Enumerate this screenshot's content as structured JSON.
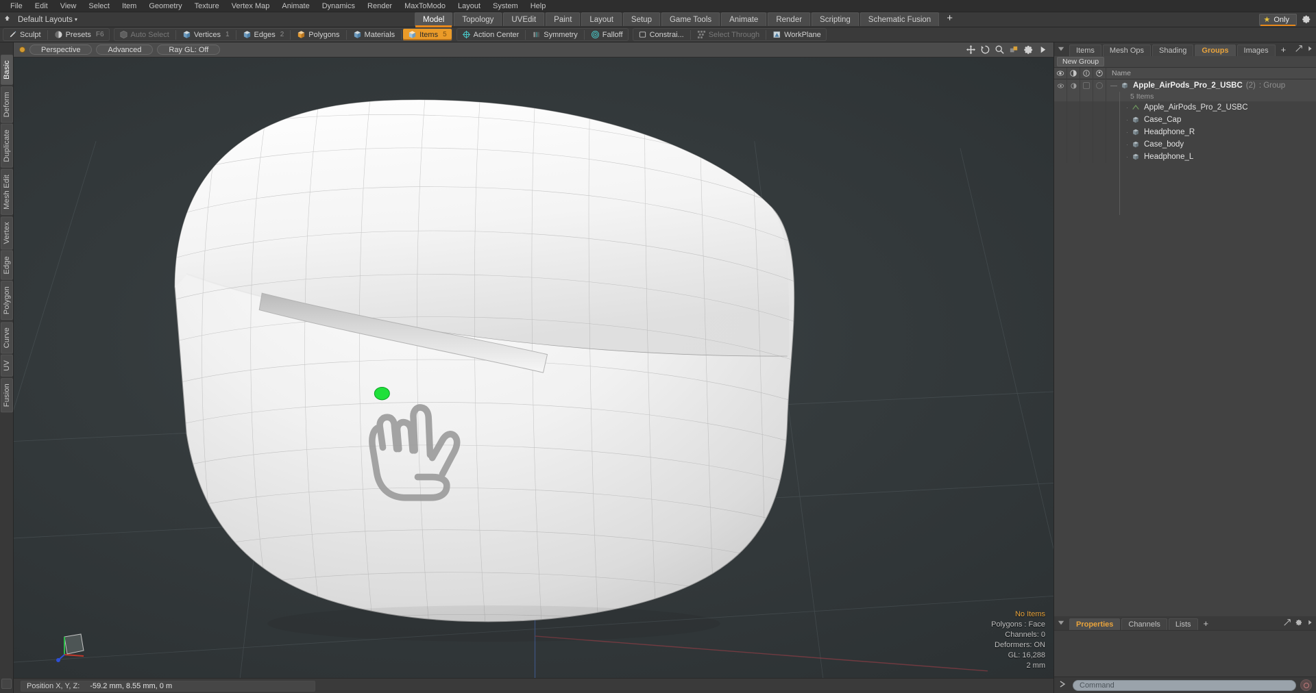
{
  "app": {
    "name": "Modo"
  },
  "menubar": {
    "items": [
      "File",
      "Edit",
      "View",
      "Select",
      "Item",
      "Geometry",
      "Texture",
      "Vertex Map",
      "Animate",
      "Dynamics",
      "Render",
      "MaxToModo",
      "Layout",
      "System",
      "Help"
    ]
  },
  "layoutrow": {
    "up_icon": "up-arrow-icon",
    "default_layouts": "Default Layouts",
    "caret": "▾",
    "tabs": [
      {
        "label": "Model",
        "selected": true
      },
      {
        "label": "Topology",
        "selected": false
      },
      {
        "label": "UVEdit",
        "selected": false
      },
      {
        "label": "Paint",
        "selected": false
      },
      {
        "label": "Layout",
        "selected": false
      },
      {
        "label": "Setup",
        "selected": false
      },
      {
        "label": "Game Tools",
        "selected": false
      },
      {
        "label": "Animate",
        "selected": false
      },
      {
        "label": "Render",
        "selected": false
      },
      {
        "label": "Scripting",
        "selected": false
      },
      {
        "label": "Schematic Fusion",
        "selected": false
      }
    ],
    "add_tab": "+",
    "only_label": "Only",
    "only_star": "★",
    "gear": "gear-icon"
  },
  "toolbar": {
    "groups": [
      {
        "buttons": [
          {
            "label": "Sculpt",
            "icon": "brush-icon",
            "state": "normal",
            "badge": ""
          },
          {
            "label": "Presets",
            "icon": "sphere-icon",
            "state": "normal",
            "badge": "F6"
          }
        ]
      },
      {
        "buttons": [
          {
            "label": "Auto Select",
            "icon": "cube-icon",
            "state": "dim",
            "badge": ""
          },
          {
            "label": "Vertices",
            "icon": "cube-blue-icon",
            "state": "normal",
            "badge": "1"
          },
          {
            "label": "Edges",
            "icon": "cube-blue-icon",
            "state": "normal",
            "badge": "2"
          },
          {
            "label": "Polygons",
            "icon": "cube-orange-icon",
            "state": "normal",
            "badge": ""
          },
          {
            "label": "Materials",
            "icon": "cube-blue-icon",
            "state": "normal",
            "badge": ""
          },
          {
            "label": "Items",
            "icon": "cube-orange-icon",
            "state": "active",
            "badge": "5"
          }
        ]
      },
      {
        "buttons": [
          {
            "label": "Action Center",
            "icon": "target-icon",
            "state": "normal",
            "badge": ""
          },
          {
            "label": "Symmetry",
            "icon": "mirror-icon",
            "state": "normal",
            "badge": ""
          },
          {
            "label": "Falloff",
            "icon": "circles-icon",
            "state": "normal",
            "badge": ""
          }
        ]
      },
      {
        "buttons": [
          {
            "label": "Constrai...",
            "icon": "plane-icon",
            "state": "normal",
            "badge": ""
          },
          {
            "label": "Select Through",
            "icon": "xray-icon",
            "state": "dim",
            "badge": ""
          },
          {
            "label": "WorkPlane",
            "icon": "workplane-icon",
            "state": "normal",
            "badge": ""
          }
        ]
      }
    ]
  },
  "left_tabs": {
    "items": [
      "Basic",
      "Deform",
      "Duplicate",
      "Mesh Edit",
      "Vertex",
      "Edge",
      "Polygon",
      "Curve",
      "UV",
      "Fusion"
    ],
    "selected": "Basic"
  },
  "viewport": {
    "header": {
      "dot": "viewport-menu-dot",
      "buttons": [
        "Perspective",
        "Advanced",
        "Ray GL: Off"
      ],
      "icons": [
        "move-icon",
        "rotate-icon",
        "zoom-icon",
        "fit-icon",
        "gear-icon",
        "play-icon"
      ]
    },
    "stats": {
      "selection": "No Items",
      "polygons": "Polygons : Face",
      "channels": "Channels: 0",
      "deformers": "Deformers: ON",
      "gl": "GL: 16,288",
      "units": "2 mm"
    },
    "axis_gizmo": "axis-gizmo",
    "center_handle": "center-handle-dot",
    "accent": "#e8a33c"
  },
  "statusbar": {
    "position_label": "Position X, Y, Z:",
    "position_value": "-59.2 mm, 8.55 mm, 0 m"
  },
  "right_panel": {
    "tabs": [
      {
        "label": "Items",
        "selected": false
      },
      {
        "label": "Mesh Ops",
        "selected": false
      },
      {
        "label": "Shading",
        "selected": false
      },
      {
        "label": "Groups",
        "selected": true
      },
      {
        "label": "Images",
        "selected": false
      }
    ],
    "add_tab": "+",
    "corner_icon": "panel-menu-icon",
    "right_icons": [
      "expand-icon",
      "arrow-right-icon"
    ],
    "new_group_button": "New Group",
    "tree_columns": [
      "eye-icon",
      "render-icon",
      "lock-icon",
      "select-icon"
    ],
    "name_column": "Name",
    "group": {
      "name": "Apple_AirPods_Pro_2_USBC",
      "count": "(2)",
      "type": ": Group",
      "subtitle": "5 Items",
      "icon": "group-icon"
    },
    "items": [
      {
        "name": "Apple_AirPods_Pro_2_USBC",
        "icon": "locator-icon"
      },
      {
        "name": "Case_Cap",
        "icon": "mesh-icon"
      },
      {
        "name": "Headphone_R",
        "icon": "mesh-icon"
      },
      {
        "name": "Case_body",
        "icon": "mesh-icon"
      },
      {
        "name": "Headphone_L",
        "icon": "mesh-icon"
      }
    ]
  },
  "bottom_panel": {
    "tabs": [
      {
        "label": "Properties",
        "selected": true
      },
      {
        "label": "Channels",
        "selected": false
      },
      {
        "label": "Lists",
        "selected": false
      }
    ],
    "add_tab": "+",
    "corner_icon": "panel-menu-icon",
    "right_icons": [
      "expand-icon",
      "gear-icon",
      "arrow-right-icon"
    ]
  },
  "command_bar": {
    "prompt_icon": "command-prompt-icon",
    "placeholder": "Command",
    "value": "",
    "record_button": "record-icon"
  }
}
